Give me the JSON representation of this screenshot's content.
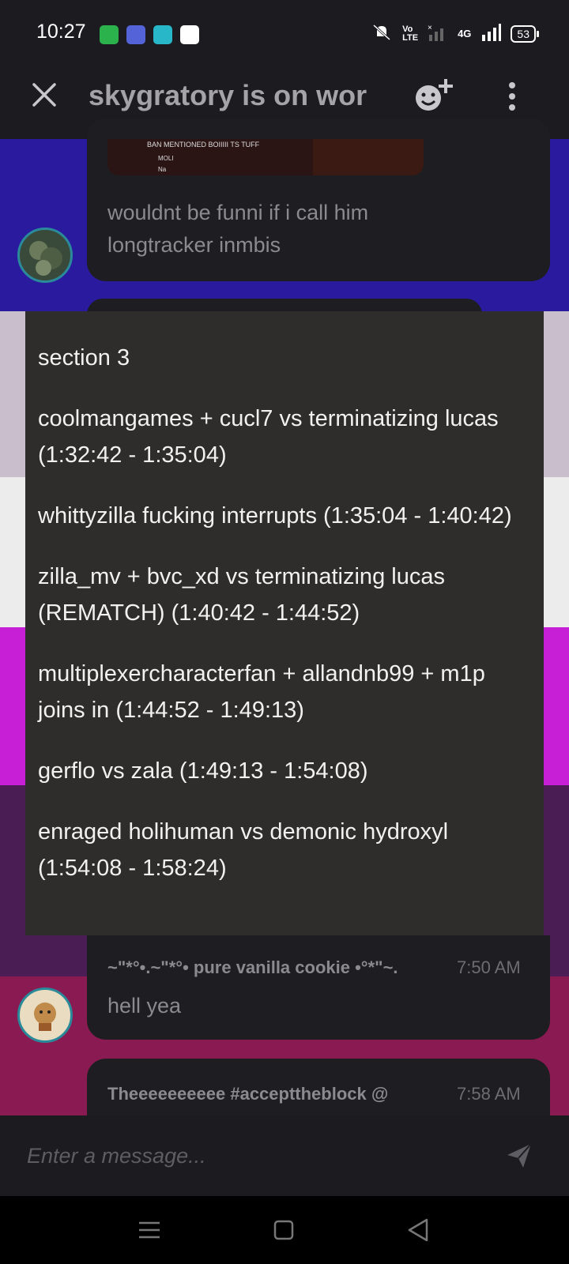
{
  "status_bar": {
    "time": "10:27",
    "network_label": "4G",
    "battery_level": "53"
  },
  "header": {
    "title": "skygratory is on wor"
  },
  "messages": [
    {
      "embed_text_1": "BAN MENTIONED BOIIIII TS TUFF",
      "embed_text_2": "MOLI",
      "embed_text_3": "Na",
      "text_line_1": "wouldnt be funni if i call him",
      "text_line_2": "longtracker inmbis"
    },
    {
      "sender": "~\"*°•.~\"*°• pure vanilla cookie •°*\"~.",
      "time": "7:50 AM",
      "text": "hell yea"
    },
    {
      "sender": "Theeeeeeeeee #accepttheblock @",
      "time": "7:58 AM"
    }
  ],
  "popup": {
    "lines": [
      "section 3",
      "coolmangames + cucl7 vs terminatizing lucas (1:32:42 - 1:35:04)",
      "whittyzilla fucking interrupts (1:35:04 - 1:40:42)",
      "zilla_mv + bvc_xd vs terminatizing lucas (REMATCH) (1:40:42 - 1:44:52)",
      "multiplexercharacterfan + allandnb99 + m1p joins in (1:44:52 - 1:49:13)",
      "gerflo vs zala (1:49:13 - 1:54:08)",
      "enraged holihuman vs demonic hydroxyl (1:54:08 - 1:58:24)"
    ]
  },
  "composer": {
    "placeholder": "Enter a message..."
  },
  "colors": {
    "stripe_blue": "#2a1a9e",
    "stripe_lavender": "#c9bfcc",
    "stripe_white": "#ececec",
    "stripe_magenta": "#c61fd6",
    "stripe_purple": "#4a1e54",
    "stripe_maroon": "#8a1a52"
  }
}
